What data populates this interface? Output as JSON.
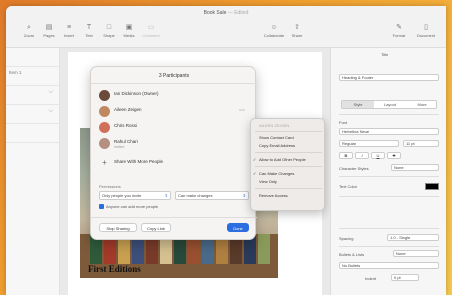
{
  "window": {
    "title": "Book Sale",
    "title_suffix": "Edited"
  },
  "toolbar": {
    "items": [
      {
        "label": "Zoom",
        "icon": "zoom-icon"
      },
      {
        "label": "Pages",
        "icon": "pages-icon"
      },
      {
        "label": "Insert",
        "icon": "insert-icon"
      },
      {
        "label": "Text",
        "icon": "text-icon"
      },
      {
        "label": "Shape",
        "icon": "shape-icon"
      },
      {
        "label": "Media",
        "icon": "media-icon"
      },
      {
        "label": "Comment",
        "icon": "comment-icon"
      },
      {
        "label": "Collaborate",
        "icon": "collaborate-icon"
      },
      {
        "label": "Share",
        "icon": "share-icon"
      },
      {
        "label": "Format",
        "icon": "format-icon"
      },
      {
        "label": "Document",
        "icon": "document-icon"
      }
    ]
  },
  "sidebar": {
    "rows": [
      {
        "label": ""
      },
      {
        "label": "Item 1"
      },
      {
        "label": ""
      },
      {
        "label": ""
      },
      {
        "label": ""
      }
    ]
  },
  "document": {
    "heading": "First Editions"
  },
  "dialog": {
    "title": "3 Participants",
    "participants": [
      {
        "name": "Ian Dickinson (Owner)",
        "sub": "",
        "color": "#6a4a3a"
      },
      {
        "name": "Aileen Zeigen",
        "sub": "",
        "color": "#c08860"
      },
      {
        "name": "Chris Rossi",
        "sub": "",
        "color": "#d0705a"
      },
      {
        "name": "Rahul Chari",
        "sub": "Invited",
        "color": "#b59080"
      }
    ],
    "add_label": "Share With More People",
    "permissions_label": "Permissions",
    "who_can_access": "Only people you invite",
    "who_can_edit": "Can make changes",
    "allow_others_label": "Anyone can add more people",
    "stop_button": "Stop Sharing",
    "copy_link_button": "Copy Link",
    "done_button": "Done"
  },
  "popup": {
    "header": "AILEEN ZEIGEN",
    "items": [
      {
        "label": "Show Contact Card",
        "checked": false,
        "dim": false
      },
      {
        "label": "Copy Email Address",
        "checked": false,
        "dim": false
      },
      {
        "label": "Allow to Add Other People",
        "checked": true,
        "dim": false
      },
      {
        "label": "Can Make Changes",
        "checked": true,
        "dim": false
      },
      {
        "label": "View Only",
        "checked": false,
        "dim": false
      },
      {
        "label": "Remove Access",
        "checked": false,
        "dim": false
      }
    ]
  },
  "inspector": {
    "top_label": "Title",
    "paragraph_style": "Heading & Footer",
    "tabs": [
      "Style",
      "Layout",
      "More"
    ],
    "font_label": "Font",
    "font_name": "Helvetica Neue",
    "font_style": "Regular",
    "font_size": "11 pt",
    "bold": "B",
    "italic": "I",
    "underline": "U",
    "strike": "S",
    "char_styles_label": "Character Styles",
    "char_styles_value": "None",
    "text_color_label": "Text Color",
    "text_color": "#000000",
    "spacing_label": "Spacing",
    "spacing_value": "1.0 - Single",
    "bullets_label": "Bullets & Lists",
    "bullets_value": "None",
    "no_bullets": "No Bullets",
    "indent_label": "Indent",
    "indent_value": "0 pt",
    "accent_color": "#2b6ee0"
  }
}
